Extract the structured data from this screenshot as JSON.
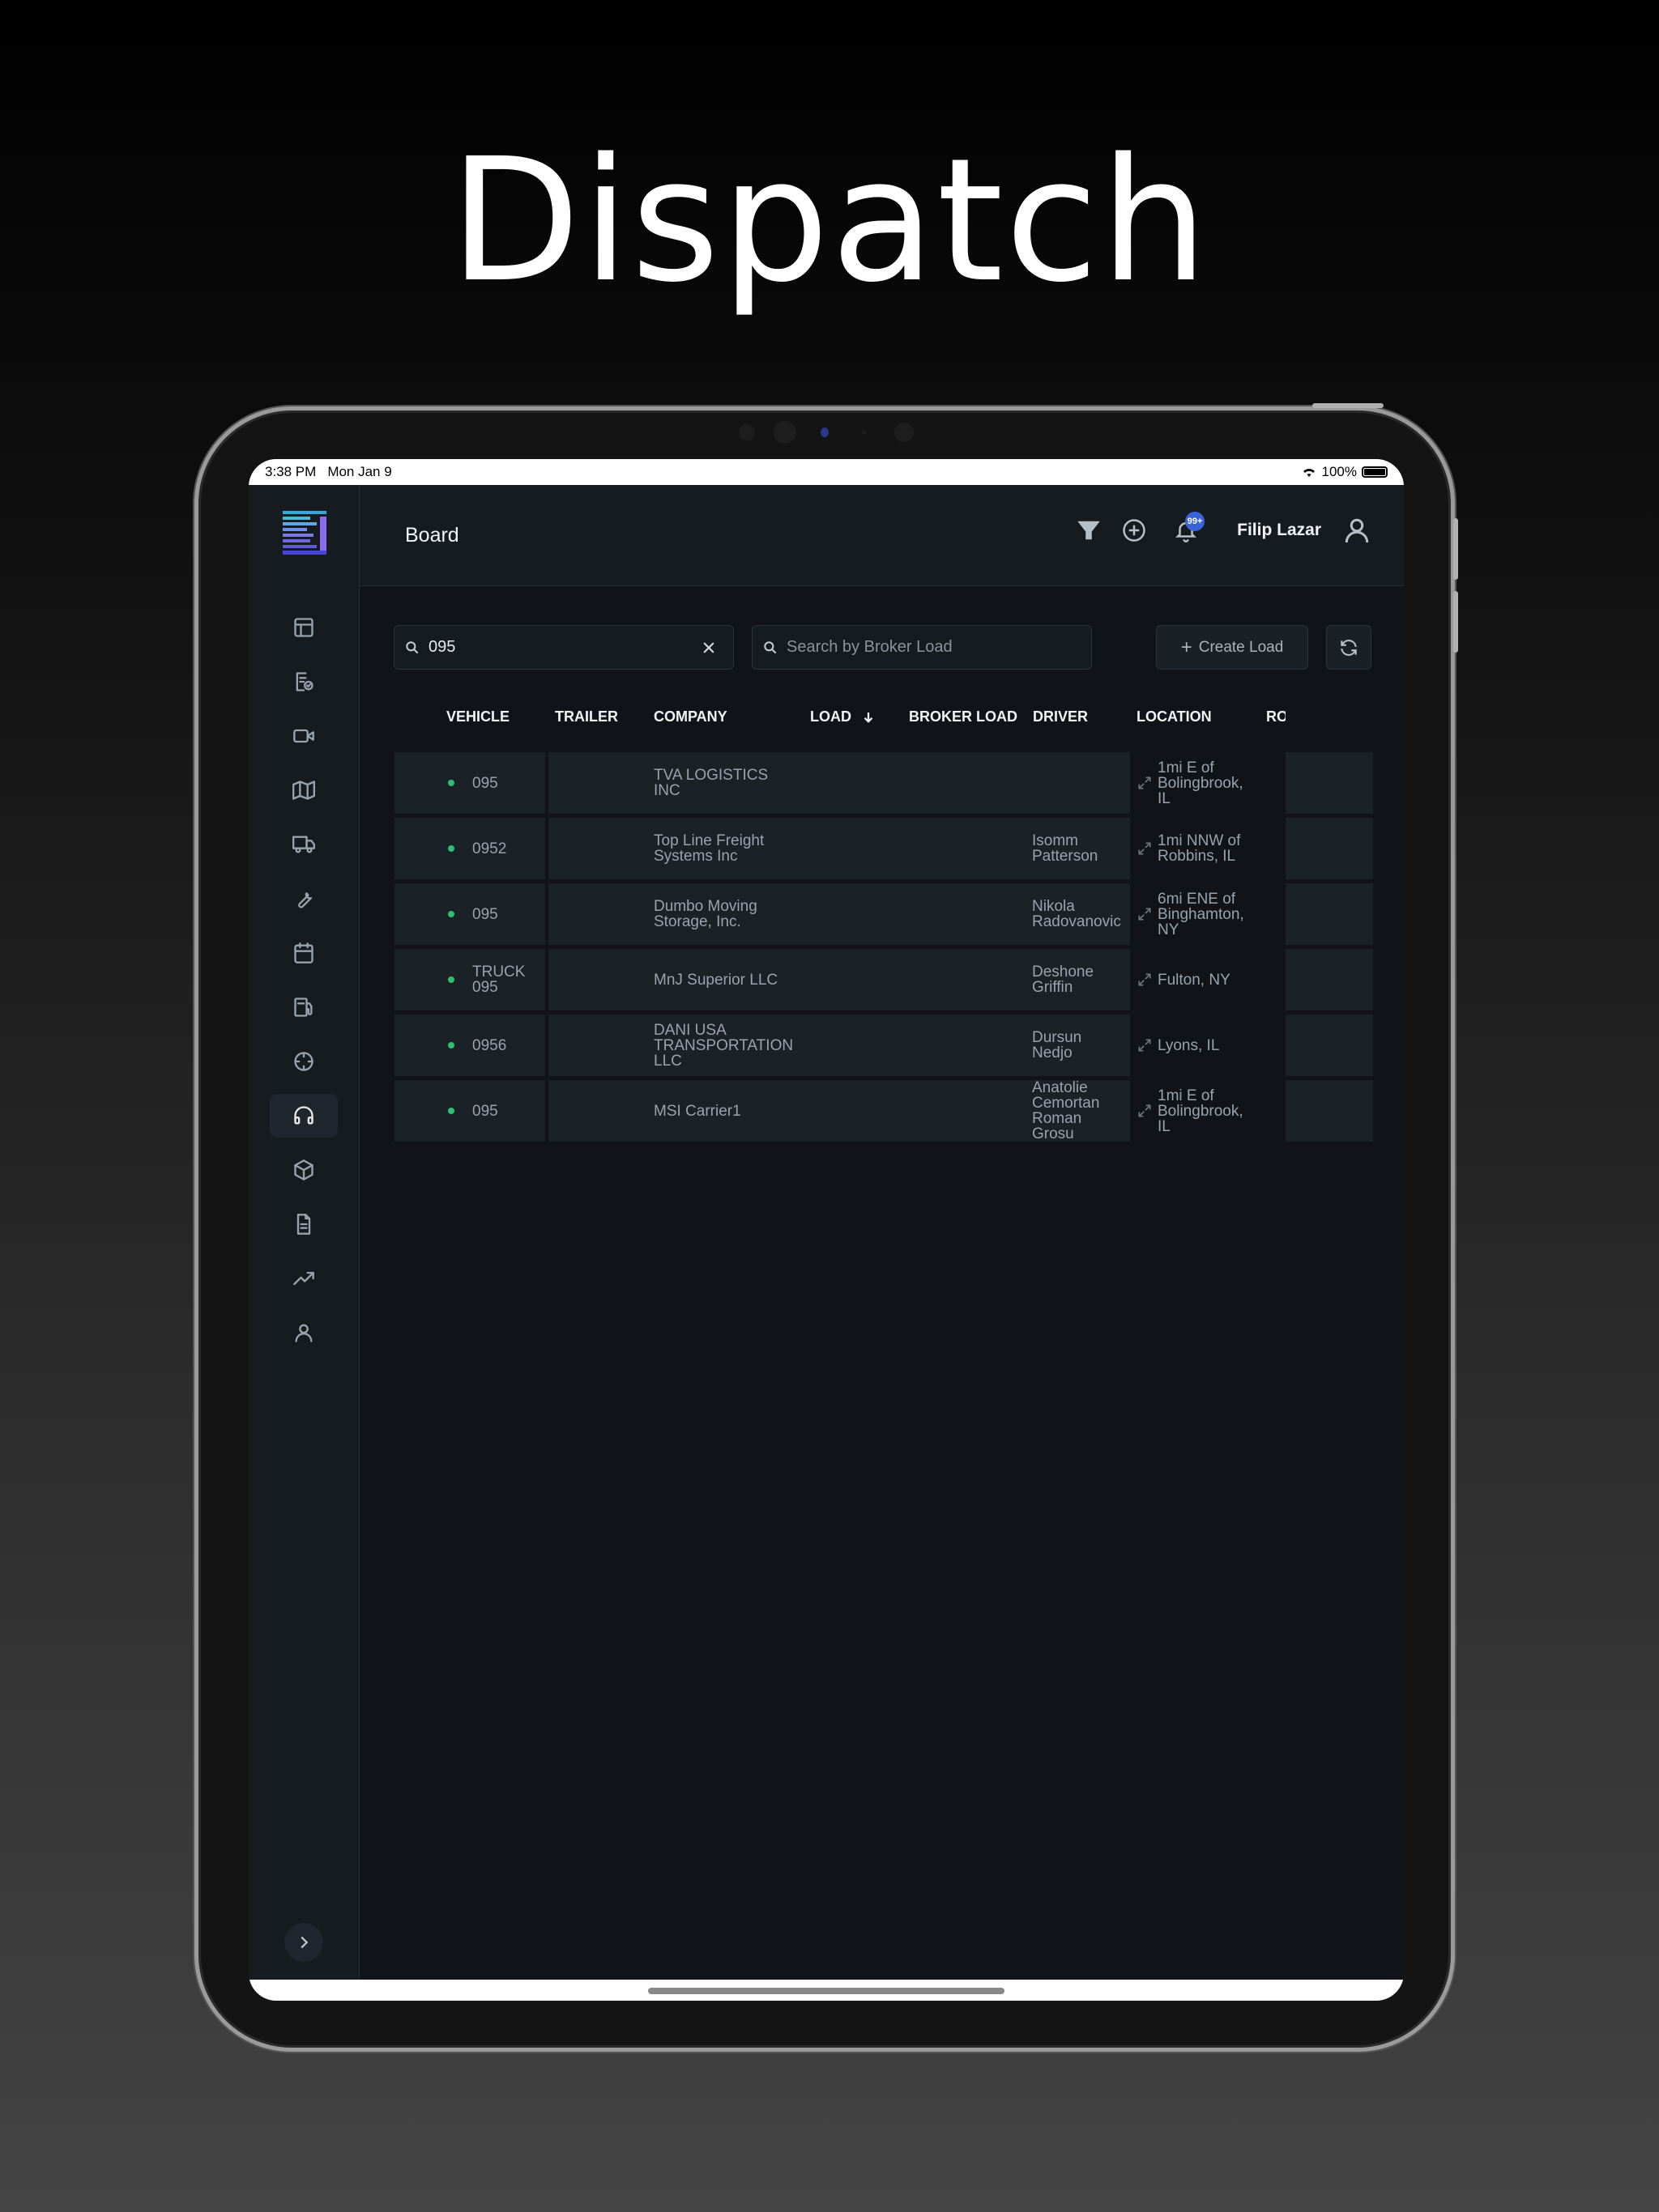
{
  "headline": "Dispatch",
  "status_bar": {
    "time": "3:38 PM",
    "date": "Mon Jan 9",
    "battery": "100%"
  },
  "header": {
    "title": "Board",
    "notification_badge": "99+",
    "user_name": "Filip Lazar"
  },
  "sidebar": {
    "items": [
      {
        "icon": "layout-icon"
      },
      {
        "icon": "document-check-icon"
      },
      {
        "icon": "video-icon"
      },
      {
        "icon": "map-icon"
      },
      {
        "icon": "truck-icon"
      },
      {
        "icon": "wrench-icon"
      },
      {
        "icon": "calendar-icon"
      },
      {
        "icon": "fuel-icon"
      },
      {
        "icon": "compass-icon"
      },
      {
        "icon": "headphones-icon",
        "active": true
      },
      {
        "icon": "box-icon"
      },
      {
        "icon": "file-text-icon"
      },
      {
        "icon": "trending-up-icon"
      },
      {
        "icon": "user-icon"
      }
    ]
  },
  "search": {
    "vehicle_value": "095",
    "broker_placeholder": "Search by Broker Load"
  },
  "actions": {
    "create_load": "Create Load"
  },
  "table": {
    "columns": [
      "VEHICLE",
      "TRAILER",
      "COMPANY",
      "LOAD",
      "BROKER LOAD",
      "DRIVER",
      "LOCATION",
      "RO"
    ],
    "rows": [
      {
        "vehicle": [
          "095"
        ],
        "company": [
          "TVA LOGISTICS",
          "INC"
        ],
        "driver": [],
        "location": [
          "1mi E of",
          "Bolingbrook,",
          "IL"
        ]
      },
      {
        "vehicle": [
          "0952"
        ],
        "company": [
          "Top Line Freight",
          "Systems Inc"
        ],
        "driver": [
          "Isomm",
          "Patterson"
        ],
        "location": [
          "1mi NNW of",
          "Robbins, IL"
        ]
      },
      {
        "vehicle": [
          "095"
        ],
        "company": [
          "Dumbo Moving",
          "Storage, Inc."
        ],
        "driver": [
          "Nikola",
          "Radovanovic"
        ],
        "location": [
          "6mi ENE of",
          "Binghamton,",
          "NY"
        ]
      },
      {
        "vehicle": [
          "TRUCK",
          "095"
        ],
        "company": [
          "MnJ Superior LLC"
        ],
        "driver": [
          "Deshone",
          "Griffin"
        ],
        "location": [
          "Fulton, NY"
        ]
      },
      {
        "vehicle": [
          "0956"
        ],
        "company": [
          "DANI USA",
          "TRANSPORTATION",
          "LLC"
        ],
        "driver": [
          "Dursun",
          "Nedjo"
        ],
        "location": [
          "Lyons, IL"
        ]
      },
      {
        "vehicle": [
          "095"
        ],
        "company": [
          "MSI Carrier1"
        ],
        "driver": [
          "Anatolie",
          "Cemortan",
          "Roman",
          "Grosu"
        ],
        "location": [
          "1mi E of",
          "Bolingbrook,",
          "IL"
        ]
      }
    ]
  },
  "colors": {
    "accent": "#3b63d9",
    "status_green": "#2fbf71",
    "background": "#101418"
  }
}
